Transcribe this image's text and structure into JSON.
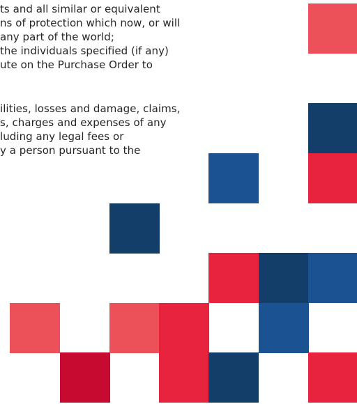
{
  "document": {
    "lines": [
      "ts and all similar or equivalent",
      "ns of protection which now, or will",
      " any part of the world;",
      " the individuals specified (if any)",
      "ute on the Purchase Order to",
      "ilities, losses and damage, claims,",
      "s, charges and expenses of any",
      "luding any legal fees or",
      "y a person pursuant to the"
    ]
  },
  "decoration": {
    "colors": {
      "coral": "#ec5058",
      "red": "#e8233e",
      "crimson": "#c60a30",
      "navy": "#133e6a",
      "blue": "#1b5392"
    },
    "tiles": [
      {
        "name": "coral-tile-top-right",
        "color": "coral"
      },
      {
        "name": "navy-tile-right-upper",
        "color": "navy"
      },
      {
        "name": "red-tile-right-middle",
        "color": "red"
      },
      {
        "name": "blue-tile-middle",
        "color": "blue"
      },
      {
        "name": "navy-tile-center",
        "color": "navy"
      },
      {
        "name": "red-tile-row1-a",
        "color": "red"
      },
      {
        "name": "navy-tile-row1-b",
        "color": "navy"
      },
      {
        "name": "blue-tile-row1-c",
        "color": "blue"
      },
      {
        "name": "coral-tile-row2-a",
        "color": "coral"
      },
      {
        "name": "coral-tile-row2-b",
        "color": "coral"
      },
      {
        "name": "red-tile-row2-c",
        "color": "red"
      },
      {
        "name": "blue-tile-row2-d",
        "color": "blue"
      },
      {
        "name": "crimson-tile-row3-a",
        "color": "crimson"
      },
      {
        "name": "red-tile-row3-b",
        "color": "red"
      },
      {
        "name": "navy-tile-row3-c",
        "color": "navy"
      },
      {
        "name": "red-tile-row3-d",
        "color": "red"
      }
    ]
  }
}
